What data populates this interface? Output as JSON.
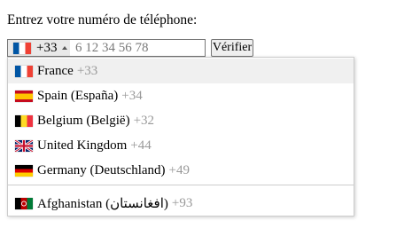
{
  "prompt": "Entrez votre numéro de téléphone:",
  "phone": {
    "selected_flag_icon": "flag-france-icon",
    "selected_dial_code": "+33",
    "placeholder": "6 12 34 56 78",
    "value": ""
  },
  "verify_button": "Vérifier",
  "dropdown": {
    "preferred": [
      {
        "name": "France",
        "code": "+33",
        "icon": "flag-france-icon"
      },
      {
        "name": "Spain (España)",
        "code": "+34",
        "icon": "flag-spain-icon"
      },
      {
        "name": "Belgium (België)",
        "code": "+32",
        "icon": "flag-belgium-icon"
      },
      {
        "name": "United Kingdom",
        "code": "+44",
        "icon": "flag-united-kingdom-icon"
      },
      {
        "name": "Germany (Deutschland)",
        "code": "+49",
        "icon": "flag-germany-icon"
      }
    ],
    "all": [
      {
        "name": "Afghanistan (‫افغانستان‬‎)",
        "code": "+93",
        "icon": "flag-afghanistan-icon"
      }
    ],
    "highlighted": "France"
  },
  "colors": {
    "highlight_bg": "#f0f0f0",
    "dial_code_text": "#999999",
    "selector_bg": "#e9e9e9"
  }
}
